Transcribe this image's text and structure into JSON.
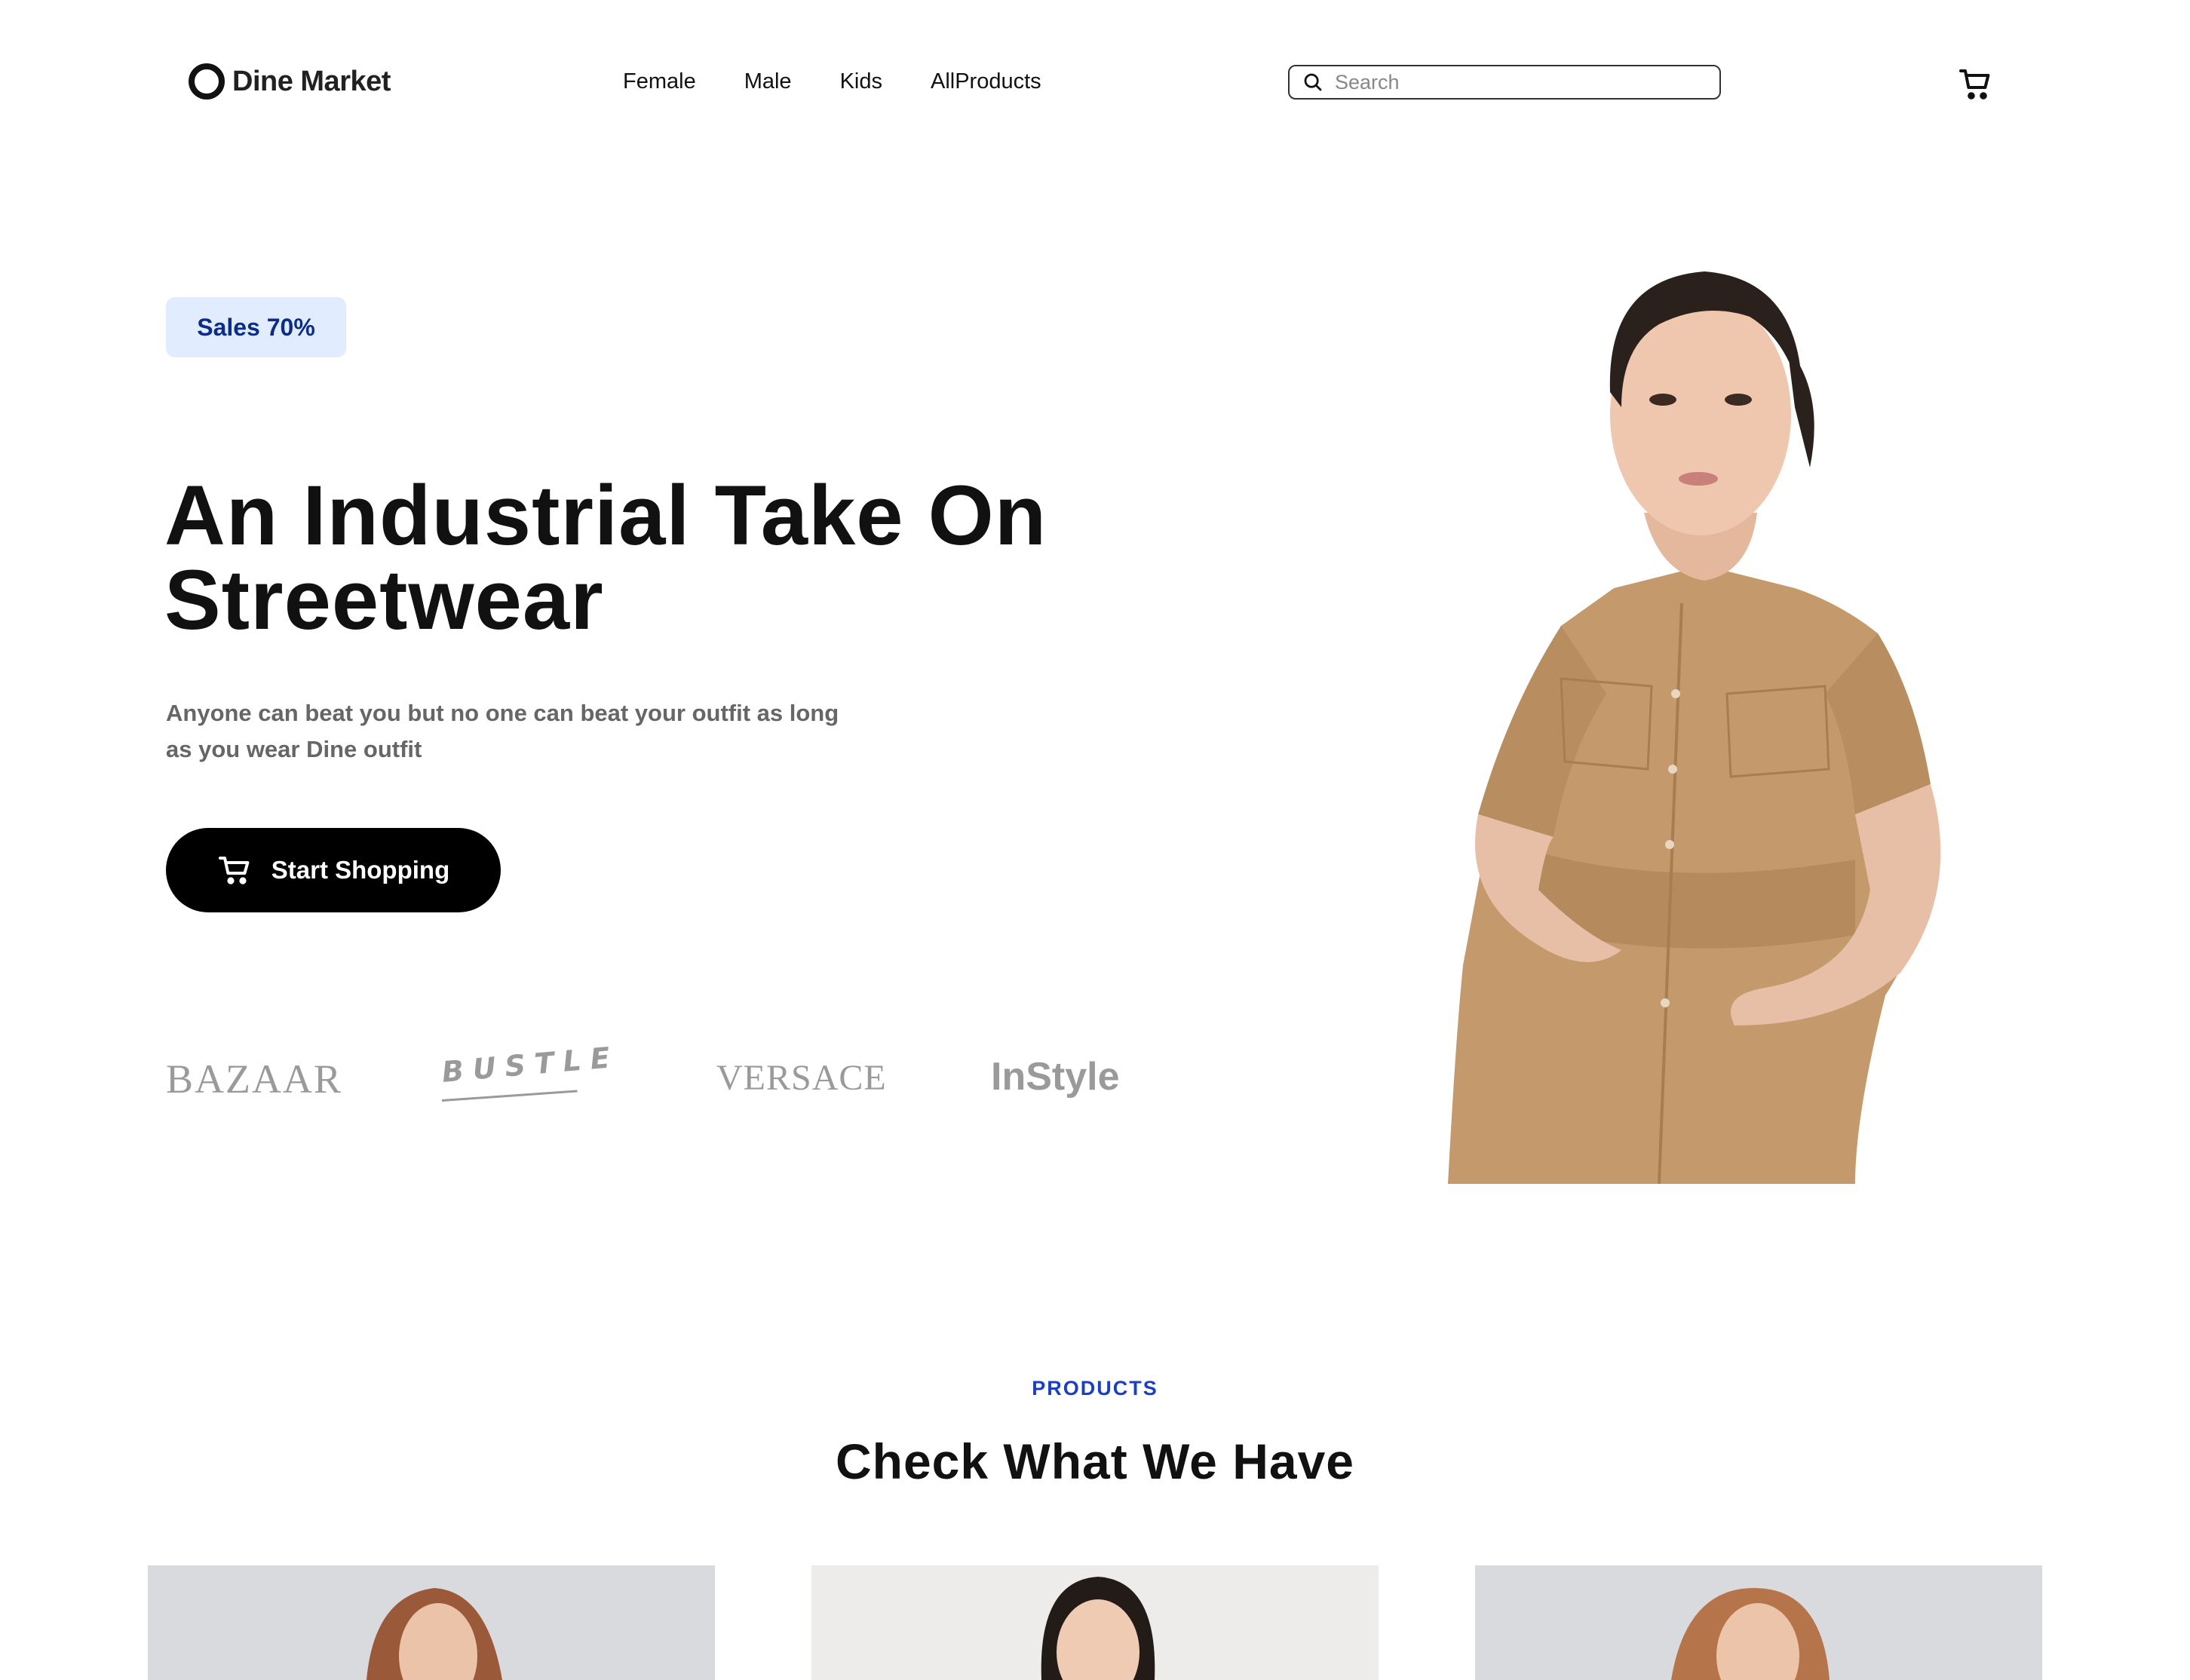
{
  "header": {
    "logo_text": "Dine Market",
    "nav": [
      "Female",
      "Male",
      "Kids",
      "AllProducts"
    ],
    "search_placeholder": "Search"
  },
  "hero": {
    "badge": "Sales 70%",
    "title": "An Industrial Take On Streetwear",
    "subtitle": "Anyone can beat you but no one can beat your outfit as long as you wear Dine outfit",
    "cta_label": "Start Shopping",
    "brands": [
      "BAZAAR",
      "BUSTLE",
      "VERSACE",
      "InStyle"
    ]
  },
  "products": {
    "label": "PRODUCTS",
    "title": "Check What We Have"
  },
  "colors": {
    "badge_bg": "#e1edff",
    "badge_text": "#0c2c8a",
    "accent_blue": "#1b3fc4",
    "cta_bg": "#000000"
  }
}
